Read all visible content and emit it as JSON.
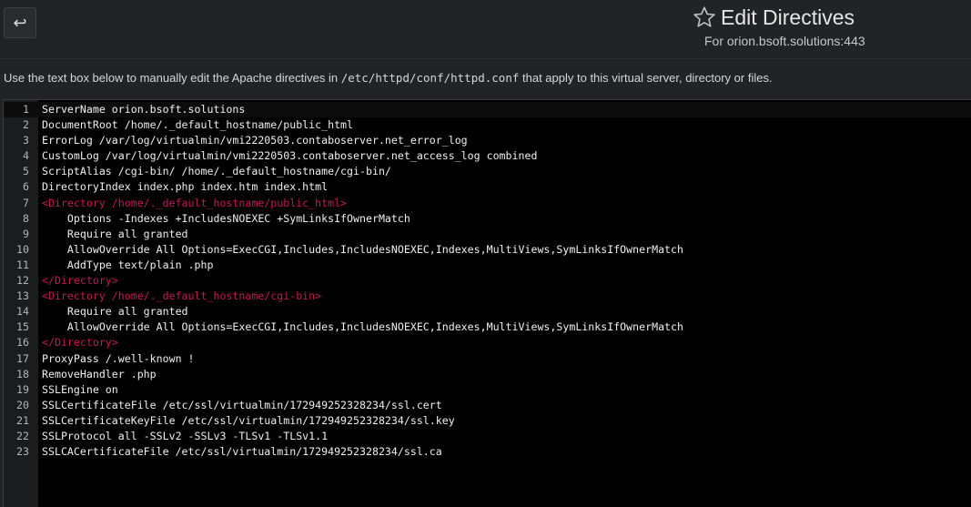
{
  "header": {
    "back_icon": "↩",
    "title": "Edit Directives",
    "subtitle": "For orion.bsoft.solutions:443"
  },
  "description": {
    "before": "Use the text box below to manually edit the Apache directives in ",
    "path": "/etc/httpd/conf/httpd.conf",
    "after": " that apply to this virtual server, directory or files."
  },
  "editor": {
    "lines": [
      {
        "n": "1",
        "text": "ServerName orion.bsoft.solutions",
        "tag": false
      },
      {
        "n": "2",
        "text": "DocumentRoot /home/._default_hostname/public_html",
        "tag": false
      },
      {
        "n": "3",
        "text": "ErrorLog /var/log/virtualmin/vmi2220503.contaboserver.net_error_log",
        "tag": false
      },
      {
        "n": "4",
        "text": "CustomLog /var/log/virtualmin/vmi2220503.contaboserver.net_access_log combined",
        "tag": false
      },
      {
        "n": "5",
        "text": "ScriptAlias /cgi-bin/ /home/._default_hostname/cgi-bin/",
        "tag": false
      },
      {
        "n": "6",
        "text": "DirectoryIndex index.php index.htm index.html",
        "tag": false
      },
      {
        "n": "7",
        "text": "<Directory /home/._default_hostname/public_html>",
        "tag": true
      },
      {
        "n": "8",
        "text": "    Options -Indexes +IncludesNOEXEC +SymLinksIfOwnerMatch",
        "tag": false
      },
      {
        "n": "9",
        "text": "    Require all granted",
        "tag": false
      },
      {
        "n": "10",
        "text": "    AllowOverride All Options=ExecCGI,Includes,IncludesNOEXEC,Indexes,MultiViews,SymLinksIfOwnerMatch",
        "tag": false
      },
      {
        "n": "11",
        "text": "    AddType text/plain .php",
        "tag": false
      },
      {
        "n": "12",
        "text": "</Directory>",
        "tag": true
      },
      {
        "n": "13",
        "text": "<Directory /home/._default_hostname/cgi-bin>",
        "tag": true
      },
      {
        "n": "14",
        "text": "    Require all granted",
        "tag": false
      },
      {
        "n": "15",
        "text": "    AllowOverride All Options=ExecCGI,Includes,IncludesNOEXEC,Indexes,MultiViews,SymLinksIfOwnerMatch",
        "tag": false
      },
      {
        "n": "16",
        "text": "</Directory>",
        "tag": true
      },
      {
        "n": "17",
        "text": "ProxyPass /.well-known !",
        "tag": false
      },
      {
        "n": "18",
        "text": "RemoveHandler .php",
        "tag": false
      },
      {
        "n": "19",
        "text": "SSLEngine on",
        "tag": false
      },
      {
        "n": "20",
        "text": "SSLCertificateFile /etc/ssl/virtualmin/172949252328234/ssl.cert",
        "tag": false
      },
      {
        "n": "21",
        "text": "SSLCertificateKeyFile /etc/ssl/virtualmin/172949252328234/ssl.key",
        "tag": false
      },
      {
        "n": "22",
        "text": "SSLProtocol all -SSLv2 -SSLv3 -TLSv1 -TLSv1.1",
        "tag": false
      },
      {
        "n": "23",
        "text": "SSLCACertificateFile /etc/ssl/virtualmin/172949252328234/ssl.ca",
        "tag": false
      }
    ]
  }
}
